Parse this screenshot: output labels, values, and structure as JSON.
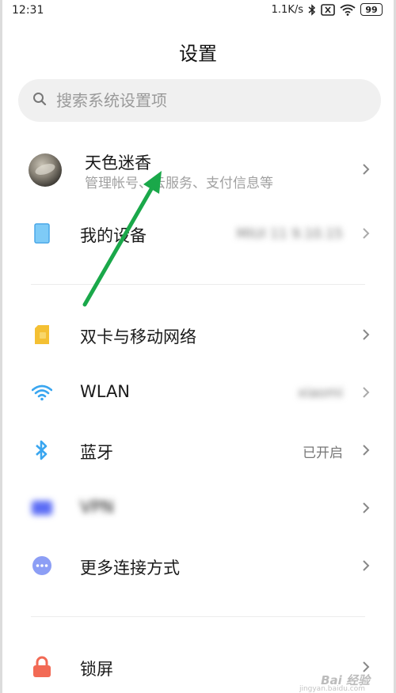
{
  "status_bar": {
    "time": "12:31",
    "network_speed": "1.1K/s",
    "battery": "99"
  },
  "header": {
    "title": "设置"
  },
  "search": {
    "placeholder": "搜索系统设置项"
  },
  "profile": {
    "name": "天色迷香",
    "subtitle": "管理帐号、云服务、支付信息等"
  },
  "items": [
    {
      "label": "我的设备",
      "value": "MIUI 11 9.10.15",
      "icon": "device-icon",
      "color": "#5bb6f5",
      "blurred_value": true
    },
    {
      "label": "双卡与移动网络",
      "value": "",
      "icon": "sim-card-icon",
      "color": "#f4c033"
    },
    {
      "label": "WLAN",
      "value": "xiaomi",
      "icon": "wifi-icon",
      "color": "#3aa6f0",
      "blurred_value": true
    },
    {
      "label": "蓝牙",
      "value": "已开启",
      "icon": "bluetooth-icon",
      "color": "#3aa6f0"
    },
    {
      "label": "VPN",
      "value": "",
      "icon": "vpn-icon",
      "color": "#5b6cf5",
      "blurred_label": true
    },
    {
      "label": "更多连接方式",
      "value": "",
      "icon": "more-connections-icon",
      "color": "#8c9ef5"
    },
    {
      "label": "锁屏",
      "value": "",
      "icon": "lock-icon",
      "color": "#f26a55"
    }
  ],
  "watermark": {
    "text": "Bai 经验",
    "sub": "jingyan.baidu.com"
  }
}
